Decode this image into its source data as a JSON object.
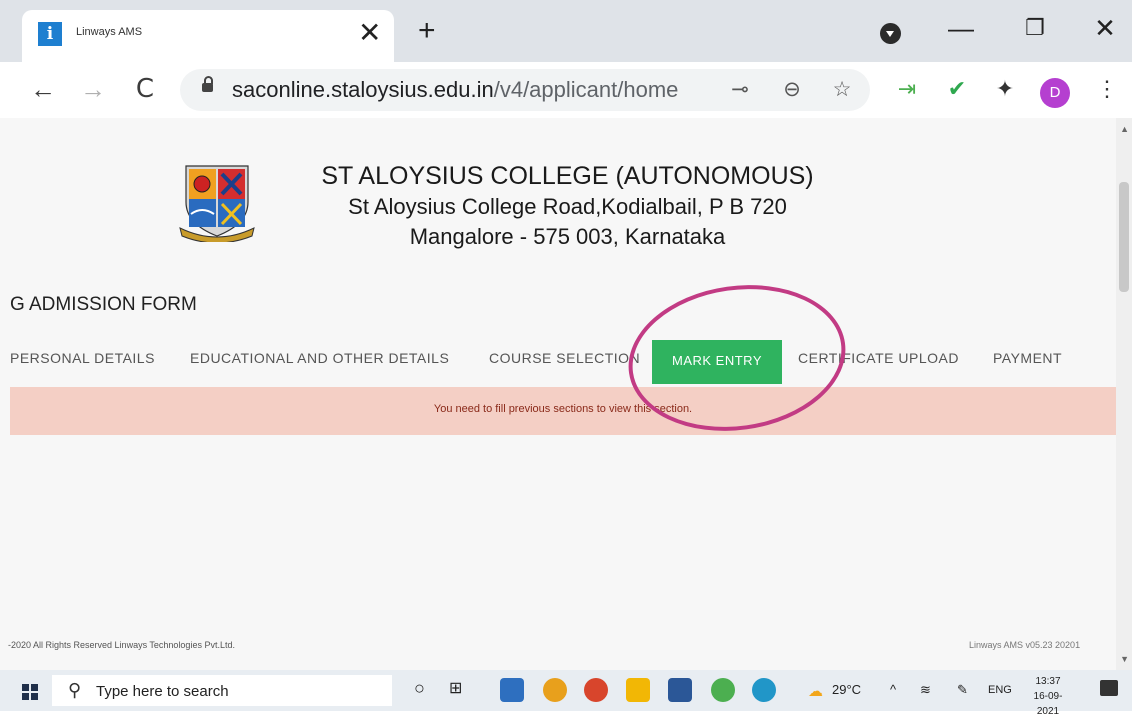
{
  "browser": {
    "tab_title": "Linways AMS",
    "tab_close": "✕",
    "new_tab": "+",
    "window_controls": {
      "minimize": "—",
      "restore": "❐",
      "close": "✕"
    },
    "nav": {
      "back": "←",
      "forward": "→",
      "reload": "C"
    },
    "url_host": "saconline.staloysius.edu.in",
    "url_path": "/v4/applicant/home",
    "profile_initial": "D",
    "icons": [
      "key-icon",
      "zoom-icon",
      "star-icon",
      "sign-in-icon",
      "checkmark-icon",
      "extensions-icon",
      "menu-icon"
    ],
    "accent_colors": {
      "favicon": "#1e7fd0",
      "check": "#2fa84f",
      "profile": "#b53fd0"
    }
  },
  "page": {
    "college_name": "ST ALOYSIUS COLLEGE (AUTONOMOUS)",
    "address_line1": "St Aloysius College Road,Kodialbail, P B 720",
    "address_line2": "Mangalore - 575 003, Karnataka",
    "form_title": "G ADMISSION FORM",
    "steps": [
      {
        "label": "PERSONAL DETAILS",
        "active": false
      },
      {
        "label": "EDUCATIONAL AND OTHER DETAILS",
        "active": false
      },
      {
        "label": "COURSE SELECTION",
        "active": false
      },
      {
        "label": "MARK ENTRY",
        "active": true
      },
      {
        "label": "CERTIFICATE UPLOAD",
        "active": false
      },
      {
        "label": "PAYMENT",
        "active": false
      }
    ],
    "alert": "You need to fill previous sections to view this section.",
    "footer_left": "-2020 All Rights Reserved Linways Technologies Pvt.Ltd.",
    "footer_right": "Linways AMS v05.23 20201",
    "colors": {
      "active_step": "#2fb35f",
      "alert_bg": "#f4cfc5",
      "annotation": "#c23b84"
    }
  },
  "taskbar": {
    "search_placeholder": "Type here to search",
    "weather": "29°C",
    "language": "ENG",
    "time": "13:37",
    "date": "16-09-2021",
    "tray_up": "^"
  }
}
